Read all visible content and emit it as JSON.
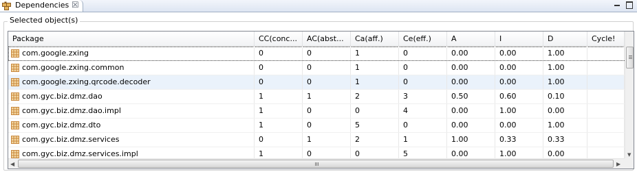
{
  "view": {
    "tab_label": "Dependencies",
    "tab_icon": "package-grid-icon",
    "close_icon": "close-icon",
    "controls": [
      "minimize-icon",
      "maximize-icon"
    ]
  },
  "group": {
    "label": "Selected object(s)"
  },
  "table": {
    "columns": [
      "Package",
      "CC(conc...",
      "AC(abst...",
      "Ca(aff.)",
      "Ce(eff.)",
      "A",
      "I",
      "D",
      "Cycle!"
    ],
    "rows": [
      {
        "package": "com.google.zxing",
        "cc": "0",
        "ac": "0",
        "ca": "1",
        "ce": "0",
        "a": "0.00",
        "i": "0.00",
        "d": "1.00",
        "cycle": ""
      },
      {
        "package": "com.google.zxing.common",
        "cc": "0",
        "ac": "0",
        "ca": "1",
        "ce": "0",
        "a": "0.00",
        "i": "0.00",
        "d": "1.00",
        "cycle": ""
      },
      {
        "package": "com.google.zxing.qrcode.decoder",
        "cc": "0",
        "ac": "0",
        "ca": "1",
        "ce": "0",
        "a": "0.00",
        "i": "0.00",
        "d": "1.00",
        "cycle": ""
      },
      {
        "package": "com.gyc.biz.dmz.dao",
        "cc": "1",
        "ac": "1",
        "ca": "2",
        "ce": "3",
        "a": "0.50",
        "i": "0.60",
        "d": "0.10",
        "cycle": ""
      },
      {
        "package": "com.gyc.biz.dmz.dao.impl",
        "cc": "1",
        "ac": "0",
        "ca": "0",
        "ce": "4",
        "a": "0.00",
        "i": "1.00",
        "d": "0.00",
        "cycle": ""
      },
      {
        "package": "com.gyc.biz.dmz.dto",
        "cc": "1",
        "ac": "0",
        "ca": "5",
        "ce": "0",
        "a": "0.00",
        "i": "0.00",
        "d": "1.00",
        "cycle": ""
      },
      {
        "package": "com.gyc.biz.dmz.services",
        "cc": "0",
        "ac": "1",
        "ca": "2",
        "ce": "1",
        "a": "1.00",
        "i": "0.33",
        "d": "0.33",
        "cycle": ""
      },
      {
        "package": "com.gyc.biz.dmz.services.impl",
        "cc": "1",
        "ac": "0",
        "ca": "0",
        "ce": "5",
        "a": "0.00",
        "i": "1.00",
        "d": "0.00",
        "cycle": ""
      }
    ],
    "selected_row": 0,
    "hover_row": 2
  },
  "colors": {
    "package_icon": "#c8863a",
    "selection_outline": "#444444",
    "hover_row": "#eaf2fb",
    "tab_strip": "#dde5f2"
  }
}
